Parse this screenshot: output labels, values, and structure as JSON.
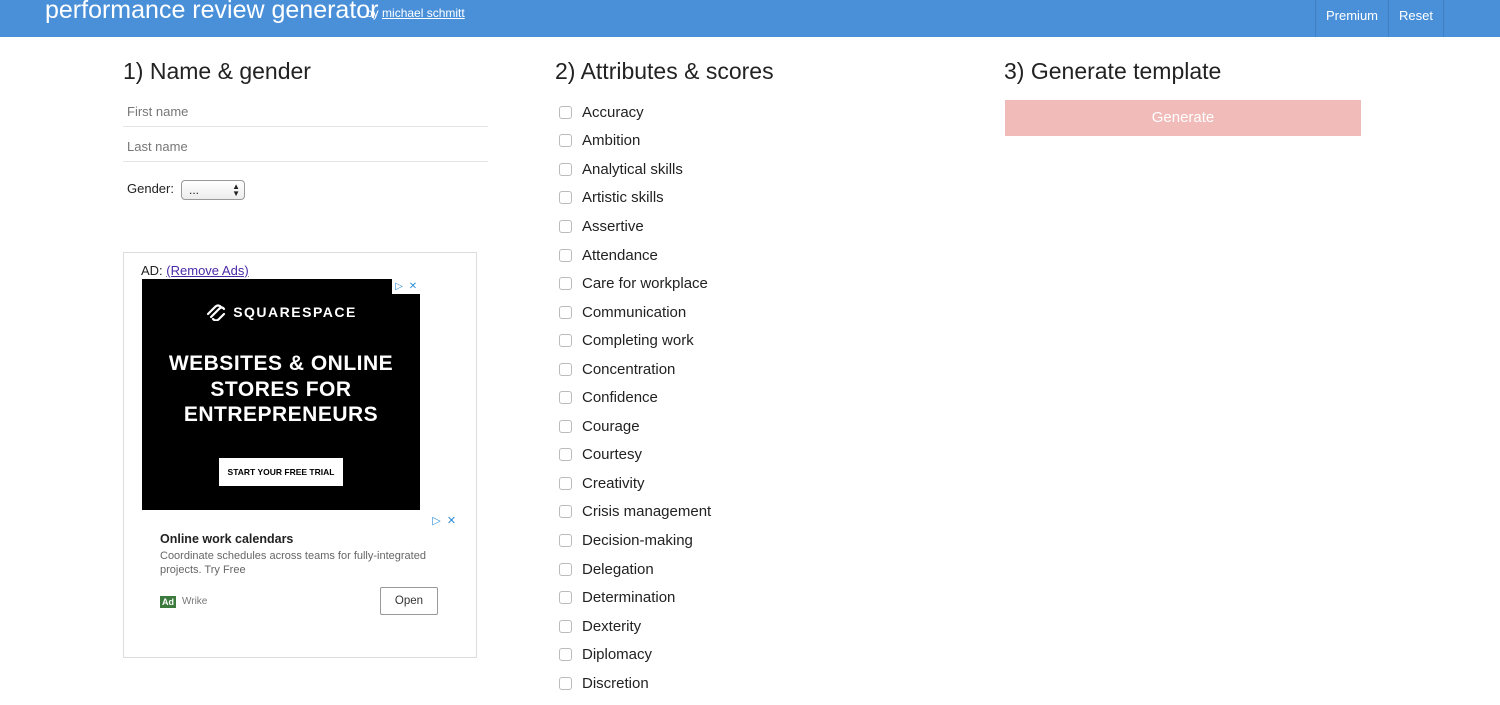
{
  "header": {
    "brand": "performance review generator",
    "by_prefix": "by",
    "author": "michael schmitt",
    "nav": [
      "Premium",
      "Reset"
    ],
    "bg_color": "#4a90d9"
  },
  "step1": {
    "title": "1) Name & gender",
    "first_name_placeholder": "First name",
    "last_name_placeholder": "Last name",
    "gender_label": "Gender:",
    "gender_value": "..."
  },
  "ad": {
    "label_prefix": "AD:",
    "remove_link": "(Remove Ads)",
    "banner": {
      "brand": "SQUARESPACE",
      "headline": "WEBSITES & ONLINE\nSTORES FOR\nENTREPRENEURS",
      "cta": "START YOUR FREE TRIAL"
    },
    "native": {
      "title": "Online work calendars",
      "description": "Coordinate schedules across teams for fully-integrated projects. Try Free",
      "badge": "Ad",
      "advertiser": "Wrike",
      "button": "Open"
    }
  },
  "step2": {
    "title": "2) Attributes & scores",
    "attributes": [
      "Accuracy",
      "Ambition",
      "Analytical skills",
      "Artistic skills",
      "Assertive",
      "Attendance",
      "Care for workplace",
      "Communication",
      "Completing work",
      "Concentration",
      "Confidence",
      "Courage",
      "Courtesy",
      "Creativity",
      "Crisis management",
      "Decision-making",
      "Delegation",
      "Determination",
      "Dexterity",
      "Diplomacy",
      "Discretion"
    ]
  },
  "step3": {
    "title": "3) Generate template",
    "button": "Generate",
    "button_color": "#f0bbb8"
  }
}
